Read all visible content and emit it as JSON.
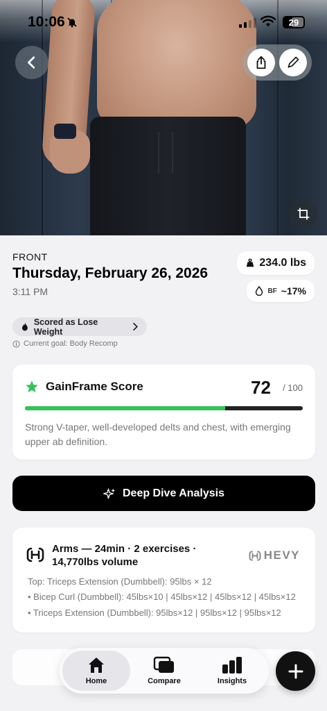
{
  "status_bar": {
    "time": "10:06",
    "battery": "29"
  },
  "photo": {
    "view": "FRONT"
  },
  "entry": {
    "date": "Thursday, February 26, 2026",
    "time": "3:11 PM",
    "weight": "234.0 lbs",
    "bf_label": "BF",
    "bf_value": "~17%"
  },
  "goal": {
    "pill_label": "Scored as Lose Weight",
    "current_goal": "Current goal: Body Recomp"
  },
  "score": {
    "title": "GainFrame Score",
    "value": "72",
    "max": "/ 100",
    "fraction": 0.72,
    "summary": "Strong V-taper, well-developed delts and chest, with emerging upper ab definition."
  },
  "deep_dive": {
    "label": "Deep Dive Analysis"
  },
  "workout": {
    "title": "Arms — 24min · 2 exercises · 14,770lbs volume",
    "source": "HEVY",
    "top": "Top: Triceps Extension (Dumbbell): 95lbs × 12",
    "lines": [
      "• Bicep Curl (Dumbbell): 45lbs×10 | 45lbs×12 | 45lbs×12 | 45lbs×12",
      "• Triceps Extension (Dumbbell): 95lbs×12 | 95lbs×12 | 95lbs×12"
    ]
  },
  "tabs": [
    {
      "label": "Home",
      "icon": "home-icon"
    },
    {
      "label": "Compare",
      "icon": "compare-icon"
    },
    {
      "label": "Insights",
      "icon": "insights-icon"
    }
  ],
  "colors": {
    "accent_green": "#36c25c",
    "dark": "#111111",
    "background": "#f2f2f5"
  }
}
